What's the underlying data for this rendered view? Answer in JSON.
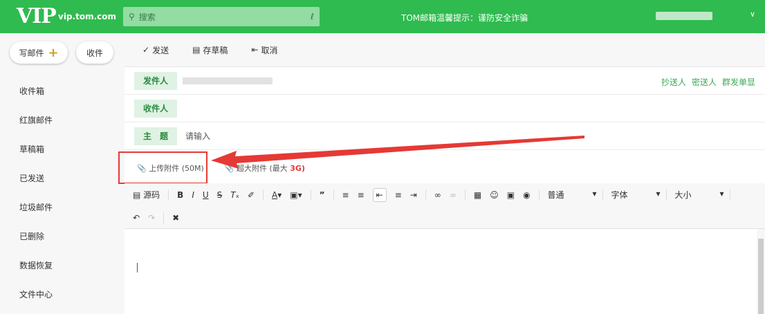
{
  "header": {
    "logo": "VIP",
    "domain": "vip.tom.com",
    "search_placeholder": "搜索",
    "notice": "TOM邮箱温馨提示：谨防安全诈骗"
  },
  "sidebar": {
    "compose": "写邮件",
    "receive": "收件",
    "items": [
      "收件箱",
      "红旗邮件",
      "草稿箱",
      "已发送",
      "垃圾邮件",
      "已删除",
      "数据恢复",
      "文件中心"
    ]
  },
  "toolbar": {
    "send": "发送",
    "save_draft": "存草稿",
    "cancel": "取消"
  },
  "form": {
    "from_label": "发件人",
    "to_label": "收件人",
    "subject_label": "主　题",
    "subject_placeholder": "请输入",
    "links": [
      "抄送人",
      "密送人",
      "群发单显"
    ]
  },
  "attachments": {
    "upload": "上传附件 (50M)",
    "large": "超大附件 (最大",
    "large_size": "3G)"
  },
  "editor": {
    "source": "源码",
    "paragraph": "普通",
    "font": "字体",
    "size": "大小"
  }
}
